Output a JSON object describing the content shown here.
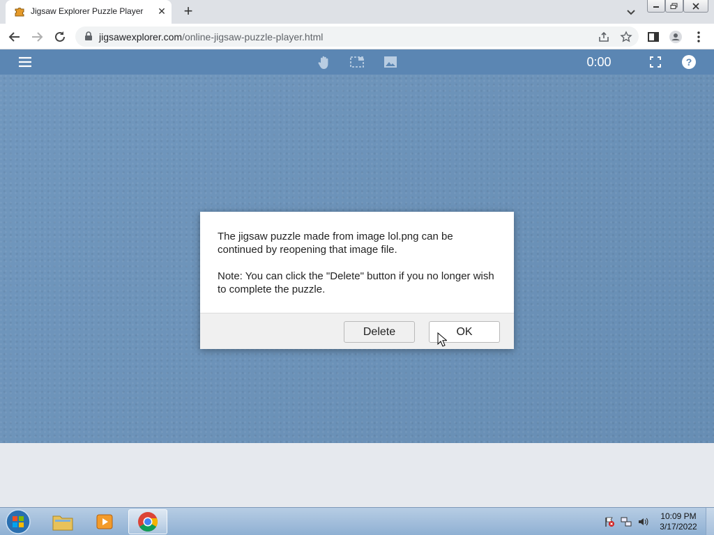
{
  "browser": {
    "tab": {
      "title": "Jigsaw Explorer Puzzle Player",
      "favicon": "puzzle-favicon",
      "close_icon": "close-icon"
    },
    "new_tab_icon": "plus-icon",
    "url": {
      "host": "jigsawexplorer.com",
      "path": "/online-jigsaw-puzzle-player.html"
    }
  },
  "app": {
    "timer": "0:00",
    "icons": [
      "menu-icon",
      "hand-icon",
      "selection-icon",
      "image-icon",
      "fullscreen-icon",
      "help-icon"
    ],
    "accent": "#5b86b3",
    "board_color": "#6b93bb"
  },
  "dialog": {
    "message": "The jigsaw puzzle made from image lol.png can be continued by reopening that image file.",
    "note": "Note: You can click the \"Delete\" button if you no longer wish to complete the puzzle.",
    "delete_label": "Delete",
    "ok_label": "OK"
  },
  "taskbar": {
    "apps": [
      "windows-explorer",
      "media-player",
      "chrome"
    ],
    "time": "10:09 PM",
    "date": "3/17/2022"
  }
}
